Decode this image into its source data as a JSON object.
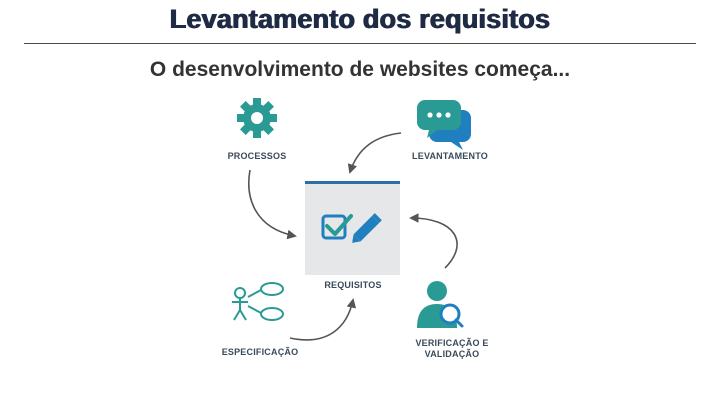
{
  "slide": {
    "title": "Levantamento dos requisitos",
    "subtitle": "O desenvolvimento de websites começa..."
  },
  "diagram": {
    "nodes": {
      "processos": "PROCESSOS",
      "levantamento": "LEVANTAMENTO",
      "requisitos": "REQUISITOS",
      "especificacao": "ESPECIFICAÇÃO",
      "verificacao_line1": "VERIFICAÇÃO E",
      "verificacao_line2": "VALIDAÇÃO"
    },
    "colors": {
      "teal": "#2a9a94",
      "blue": "#1f7fbf",
      "box": "#e6e7e9",
      "box_top": "#2b6fa8",
      "arrow": "#555555"
    },
    "icons": [
      "gear-icon",
      "chat-bubbles-icon",
      "checkbox-pencil-icon",
      "use-case-icon",
      "user-search-icon"
    ]
  }
}
